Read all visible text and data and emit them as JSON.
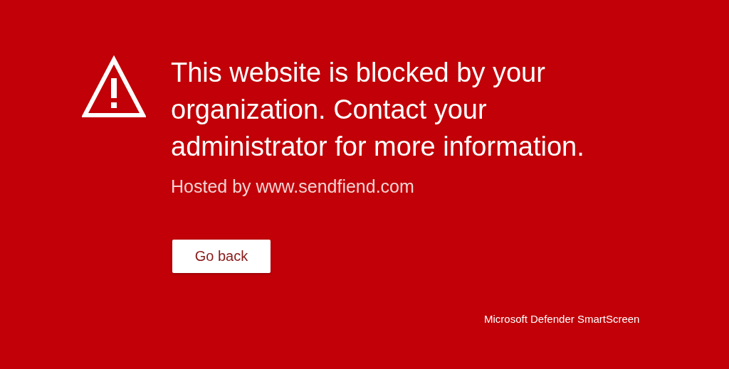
{
  "heading": "This website is blocked by your organization. Contact your administrator for more information.",
  "hosted_by": "Hosted by www.sendfiend.com",
  "button": {
    "label": "Go back"
  },
  "footer": "Microsoft Defender SmartScreen"
}
